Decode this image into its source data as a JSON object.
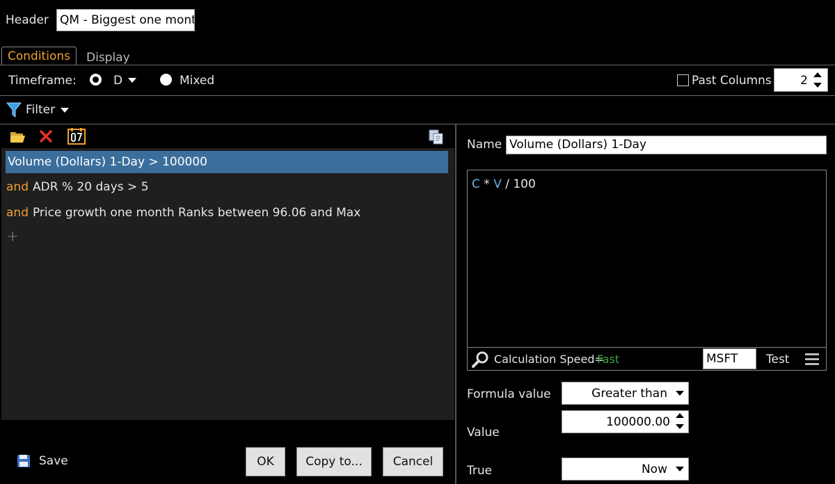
{
  "header": {
    "label": "Header",
    "value": "QM - Biggest one mont"
  },
  "tabs": [
    {
      "label": "Conditions",
      "active": true
    },
    {
      "label": "Display",
      "active": false
    }
  ],
  "timeframe": {
    "label": "Timeframe:",
    "selected_value": "D",
    "mixed_label": "Mixed",
    "past_columns_label": "Past Columns",
    "past_columns_value": "2",
    "past_columns_checked": false
  },
  "filter": {
    "label": "Filter"
  },
  "conditions": [
    {
      "keyword": "",
      "text": "Volume (Dollars) 1-Day > 100000",
      "selected": true
    },
    {
      "keyword": "and",
      "text": "ADR % 20 days > 5",
      "selected": false
    },
    {
      "keyword": "and",
      "text": "Price growth one month Ranks between 96.06 and Max",
      "selected": false
    }
  ],
  "add_symbol": "+",
  "toolbar_icons": [
    "open-folder-icon",
    "delete-icon",
    "calendar-icon",
    "copy-icon"
  ],
  "footer": {
    "save_label": "Save",
    "ok_label": "OK",
    "copy_label": "Copy to...",
    "cancel_label": "Cancel"
  },
  "detail": {
    "name_label": "Name",
    "name_value": "Volume (Dollars) 1-Day",
    "formula": {
      "c": "C",
      "star": "*",
      "v": "V",
      "rest": "/ 100"
    },
    "calc_speed_label": "Calculation Speed=",
    "calc_speed_value": "Fast",
    "test_symbol": "MSFT",
    "test_label": "Test",
    "formula_value_label": "Formula value",
    "comparison": "Greater than",
    "value_label": "Value",
    "value": "100000.00",
    "true_label": "True",
    "true_value": "Now"
  },
  "colors": {
    "accent_orange": "#f0a030",
    "selection_blue": "#3c6e9c",
    "formula_var_blue": "#6cb4e8",
    "fast_green": "#3aa53a",
    "delete_red": "#e8312a"
  }
}
